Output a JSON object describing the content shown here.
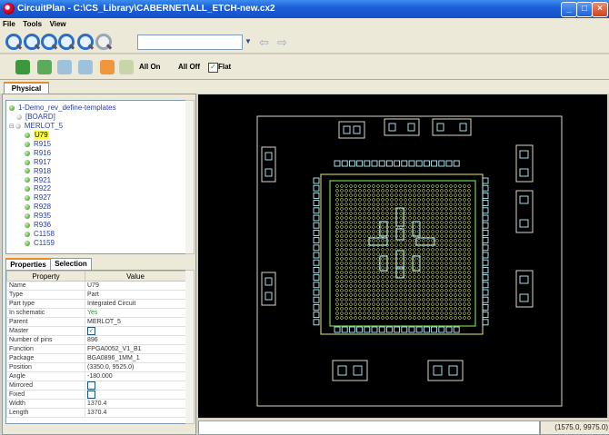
{
  "window": {
    "title": "CircuitPlan - C:\\CS_Library\\CABERNET\\ALL_ETCH-new.cx2"
  },
  "menu": [
    "File",
    "Tools",
    "View"
  ],
  "toolbar2": {
    "all_on": "All On",
    "all_off": "All Off",
    "flat_label": "Flat",
    "flat_checked": true
  },
  "tabs": {
    "physical": "Physical"
  },
  "tree": {
    "root": "1-Demo_rev_define-templates",
    "board": "[BOARD]",
    "parent": "MERLOT_5",
    "children": [
      "U79",
      "R915",
      "R916",
      "R917",
      "R918",
      "R921",
      "R922",
      "R927",
      "R928",
      "R935",
      "R936",
      "C1158",
      "C1159"
    ],
    "selected": "U79"
  },
  "properties_panel": {
    "tab_properties": "Properties",
    "tab_selection": "Selection",
    "col_property": "Property",
    "col_value": "Value",
    "rows": [
      {
        "name": "Name",
        "value": "U79"
      },
      {
        "name": "Type",
        "value": "Part"
      },
      {
        "name": "Part type",
        "value": "Integrated Circuit"
      },
      {
        "name": "In schematic",
        "value": "Yes"
      },
      {
        "name": "Parent",
        "value": "MERLOT_5"
      },
      {
        "name": "Master",
        "value": "",
        "checkbox": true
      },
      {
        "name": "Number of pins",
        "value": "896"
      },
      {
        "name": "Function",
        "value": "FPGA0052_V1_B1"
      },
      {
        "name": "Package",
        "value": "BGA0896_1MM_1"
      },
      {
        "name": "Position",
        "value": "(3350.0, 9525.0)"
      },
      {
        "name": "Angle",
        "value": "-180.000"
      },
      {
        "name": "Mirrored",
        "value": "",
        "checkbox": false
      },
      {
        "name": "Fixed",
        "value": "",
        "checkbox": false
      },
      {
        "name": "Width",
        "value": "1370.4"
      },
      {
        "name": "Length",
        "value": "1370.4"
      }
    ]
  },
  "status": {
    "coords": "(1575.0, 9975.0)"
  },
  "colors": {
    "canvas": "#000000",
    "outline": "#d7d7c8",
    "pad_green": "#6ed64a",
    "pad_yellow": "#e8ee72",
    "pad_cyan": "#b7f4ff",
    "accent_tab": "#e68b2c"
  },
  "icons": [
    "app-icon",
    "zoom-in-icon",
    "zoom-out-icon",
    "zoom-fit-icon",
    "layer-icon",
    "nav-back-icon",
    "nav-forward-icon"
  ]
}
